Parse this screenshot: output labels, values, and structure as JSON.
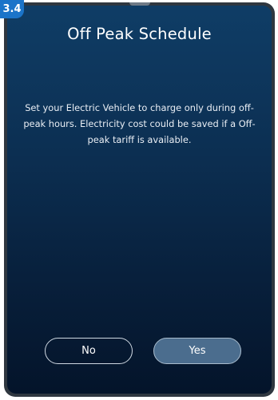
{
  "badge": {
    "label": "3.4"
  },
  "dialog": {
    "title": "Off Peak Schedule",
    "description": "Set your Electric Vehicle to charge only during off-peak hours. Electricity cost could be saved if a Off-peak tariff is available."
  },
  "actions": {
    "no_label": "No",
    "yes_label": "Yes"
  },
  "colors": {
    "badge": "#1b74c9",
    "background_top": "#0f3d66",
    "background_bottom": "#04142a",
    "yes_button": "#4b6d8e"
  }
}
